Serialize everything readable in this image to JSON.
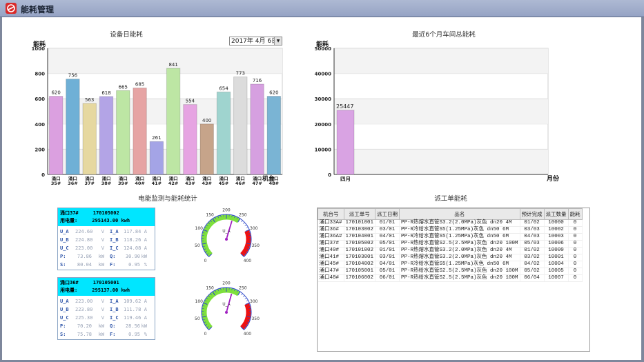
{
  "app": {
    "title": "能耗管理"
  },
  "sections": {
    "daily": "设备日能耗",
    "monthly": "最近6个月车间总能耗",
    "monitor": "电能监测与能耗统计",
    "orders": "派工单能耗"
  },
  "date_select": {
    "value": "2017年 4月 6日"
  },
  "chart_data": [
    {
      "type": "bar",
      "title": "设备日能耗",
      "ylabel": "能耗",
      "xlabel": "机台",
      "ylim": [
        0,
        1000
      ],
      "yticks": [
        0,
        200,
        400,
        600,
        800,
        1000
      ],
      "grid": true,
      "categories": [
        "涌口35#",
        "涌口36#",
        "涌口37#",
        "涌口38#",
        "涌口39#",
        "涌口40#",
        "涌口41#",
        "涌口42#",
        "涌口43#",
        "涌口43#",
        "涌口45#",
        "涌口46#",
        "涌口47#",
        "涌口48#"
      ],
      "values": [
        620,
        756,
        563,
        618,
        665,
        685,
        261,
        841,
        554,
        400,
        654,
        773,
        716,
        620
      ],
      "colors": [
        "#dba0e0",
        "#6fb0d6",
        "#e6d8a0",
        "#b3a4e6",
        "#bde6a4",
        "#e6a4a4",
        "#a4a4e6",
        "#bde6a4",
        "#e6a4e2",
        "#c6a48a",
        "#9fd4cf",
        "#dcdcdc",
        "#d6a0e0",
        "#7ab4d4"
      ]
    },
    {
      "type": "bar",
      "title": "最近6个月车间总能耗",
      "ylabel": "能耗",
      "xlabel": "月份",
      "ylim": [
        0,
        50000
      ],
      "yticks": [
        0,
        10000,
        20000,
        30000,
        40000,
        50000
      ],
      "grid": true,
      "categories": [
        "四月"
      ],
      "values": [
        25447
      ],
      "colors": [
        "#d9a3e3"
      ]
    }
  ],
  "meters": [
    {
      "name": "涌口37#",
      "code": "170105002",
      "power_label": "用电量:",
      "power": "295143.00 kwh",
      "rows": [
        [
          "U_A",
          "224.60",
          "V",
          "I_A",
          "117.84",
          "A"
        ],
        [
          "U_B",
          "224.80",
          "V",
          "I_B",
          "118.26",
          "A"
        ],
        [
          "U_C",
          "223.00",
          "V",
          "I_C",
          "124.08",
          "A"
        ],
        [
          "P:",
          "73.86",
          "kW",
          "Q:",
          "30.90",
          "kW"
        ],
        [
          "S:",
          "80.04",
          "kW",
          "F:",
          "0.95",
          "%"
        ]
      ]
    },
    {
      "name": "涌口36#",
      "code": "170105001",
      "power_label": "用电量:",
      "power": "295137.00 kwh",
      "rows": [
        [
          "U_A",
          "223.00",
          "V",
          "I_A",
          "109.62",
          "A"
        ],
        [
          "U_B",
          "223.80",
          "V",
          "I_B",
          "111.78",
          "A"
        ],
        [
          "U_C",
          "225.30",
          "V",
          "I_C",
          "119.46",
          "A"
        ],
        [
          "P:",
          "70.20",
          "kW",
          "Q:",
          "28.56",
          "kW"
        ],
        [
          "S:",
          "75.78",
          "kW",
          "F:",
          "0.95",
          "%"
        ]
      ]
    }
  ],
  "gauges": [
    {
      "label": "U_A",
      "value": 224.6,
      "min": 0,
      "max": 400,
      "ticks": [
        0,
        50,
        100,
        150,
        200,
        250,
        300,
        350,
        400
      ]
    },
    {
      "label": "U_A",
      "value": 223.0,
      "min": 0,
      "max": 400,
      "ticks": [
        0,
        50,
        100,
        150,
        200,
        250,
        300,
        350,
        400
      ]
    }
  ],
  "orders": {
    "columns": [
      "机台号",
      "派工单号",
      "派工日期",
      "品名",
      "预计完成",
      "派工数量",
      "能耗"
    ],
    "rows": [
      [
        "涌口33A#",
        "170101001",
        "01/01",
        "PP-R热熔水直管S3.2(2.0MPa)灰色 dn20 4M",
        "01/02",
        "10000",
        "0"
      ],
      [
        "涌口36#",
        "170103002",
        "03/01",
        "PP-R冷给水直管S5(1.25MPa)灰色 dn50 6M",
        "03/03",
        "10002",
        "0"
      ],
      [
        "涌口36A#",
        "170104001",
        "04/01",
        "PP-R冷给水直管S5(1.25MPa)灰色 dn50 6M",
        "04/03",
        "10003",
        "0"
      ],
      [
        "涌口37#",
        "170105002",
        "05/01",
        "PP-R热给水直管S2.5(2.5MPa)灰色 dn20 100M",
        "05/03",
        "10006",
        "0"
      ],
      [
        "涌口40#",
        "170101002",
        "01/01",
        "PP-R热熔水直管S3.2(2.0MPa)灰色 dn20 4M",
        "01/02",
        "10000",
        "0"
      ],
      [
        "涌口41#",
        "170103001",
        "03/01",
        "PP-R热熔水直管S3.2(2.0MPa)灰色 dn20 4M",
        "03/02",
        "10001",
        "0"
      ],
      [
        "涌口45#",
        "170104002",
        "04/01",
        "PP-R冷给水直管S5(1.25MPa)灰色 dn50 6M",
        "04/02",
        "10004",
        "0"
      ],
      [
        "涌口47#",
        "170105001",
        "05/01",
        "PP-R热给水直管S2.5(2.5MPa)灰色 dn20 100M",
        "05/02",
        "10005",
        "0"
      ],
      [
        "涌口48#",
        "170106002",
        "06/01",
        "PP-R热给水直管S2.5(2.5MPa)灰色 dn20 100M",
        "06/04",
        "10007",
        "0"
      ]
    ]
  }
}
